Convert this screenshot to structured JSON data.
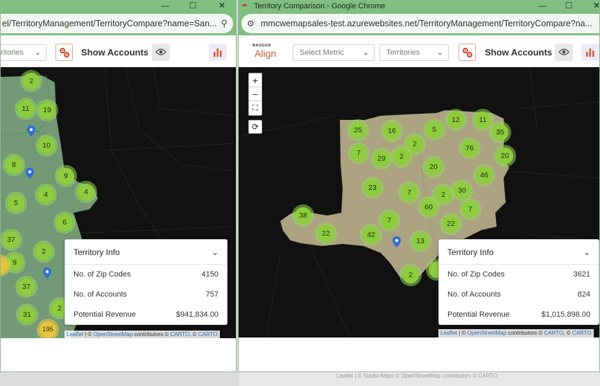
{
  "left_window": {
    "url": "el/TerritoryManagement/TerritoryCompare?name=San...",
    "territory_select": "ritories",
    "show_accounts": "Show Accounts",
    "clusters": [
      {
        "label": "2"
      },
      {
        "label": "11"
      },
      {
        "label": "19"
      },
      {
        "label": "10"
      },
      {
        "label": "8"
      },
      {
        "label": "9"
      },
      {
        "label": "4"
      },
      {
        "label": "4"
      },
      {
        "label": "5"
      },
      {
        "label": "6"
      },
      {
        "label": "37"
      },
      {
        "label": "2"
      },
      {
        "label": "9"
      },
      {
        "label": "37"
      },
      {
        "label": "31"
      },
      {
        "label": "2"
      },
      {
        "label": "195"
      }
    ],
    "info": {
      "title": "Territory Info",
      "rows": [
        {
          "label": "No. of Zip Codes",
          "value": "4150"
        },
        {
          "label": "No. of Accounts",
          "value": "757"
        },
        {
          "label": "Potential Revenue",
          "value": "$941,834.00"
        }
      ]
    },
    "attribution": {
      "leaflet": "Leaflet",
      "sep": " | © ",
      "osm": "OpenStreetMap",
      "contrib": " contributors © ",
      "carto1": "CARTO",
      "comma": ", © ",
      "carto2": "CARTO"
    }
  },
  "right_window": {
    "title": "Territory Comparison - Google Chrome",
    "url": "mmcwemapsales-test.azurewebsites.net/TerritoryManagement/TerritoryCompare?na...",
    "logo_small": "BADGER",
    "logo_big": "Align",
    "metric_select": "Select Metric",
    "territory_select": "Territories",
    "show_accounts": "Show Accounts",
    "zoom_in": "+",
    "zoom_out": "−",
    "clusters": [
      {
        "label": "25"
      },
      {
        "label": "16"
      },
      {
        "label": "2"
      },
      {
        "label": "5"
      },
      {
        "label": "12"
      },
      {
        "label": "11"
      },
      {
        "label": "35"
      },
      {
        "label": "7"
      },
      {
        "label": "29"
      },
      {
        "label": "2"
      },
      {
        "label": "76"
      },
      {
        "label": "20"
      },
      {
        "label": "20"
      },
      {
        "label": "46"
      },
      {
        "label": "23"
      },
      {
        "label": "7"
      },
      {
        "label": "2"
      },
      {
        "label": "30"
      },
      {
        "label": "60"
      },
      {
        "label": "7"
      },
      {
        "label": "38"
      },
      {
        "label": "7"
      },
      {
        "label": "22"
      },
      {
        "label": "22"
      },
      {
        "label": "42"
      },
      {
        "label": "13"
      },
      {
        "label": "2"
      }
    ],
    "info": {
      "title": "Territory Info",
      "rows": [
        {
          "label": "No. of Zip Codes",
          "value": "3621"
        },
        {
          "label": "No. of Accounts",
          "value": "824"
        },
        {
          "label": "Potential Revenue",
          "value": "$1,015,898.00"
        }
      ]
    },
    "attribution": {
      "leaflet": "Leaflet",
      "sep": " | © ",
      "osm": "OpenStreetMap",
      "contrib": " contributors © ",
      "carto1": "CARTO",
      "comma": ", © ",
      "carto2": "CARTO"
    }
  },
  "behind_text": "Leaflet | © Stadia Maps © OpenStreetMap contributors © CARTO",
  "colors": {
    "chrome": "#7fbf7f",
    "territory_left": "#7fa882",
    "territory_right": "#b9b08a",
    "cluster": "#8ccc3d",
    "accent": "#c55a2d"
  }
}
